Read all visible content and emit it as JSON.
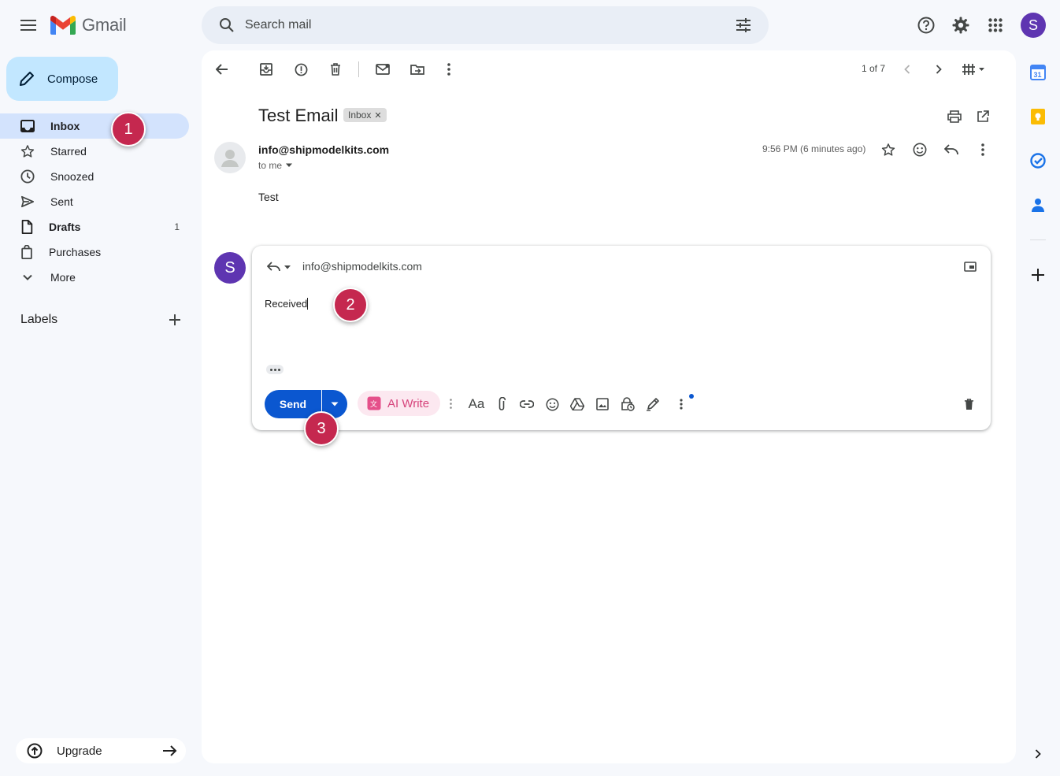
{
  "app": {
    "name": "Gmail",
    "avatar_letter": "S"
  },
  "search": {
    "placeholder": "Search mail"
  },
  "compose": {
    "label": "Compose"
  },
  "sidebar": {
    "items": [
      {
        "label": "Inbox",
        "count": "",
        "icon": "inbox-icon"
      },
      {
        "label": "Starred",
        "count": "",
        "icon": "star-icon"
      },
      {
        "label": "Snoozed",
        "count": "",
        "icon": "clock-icon"
      },
      {
        "label": "Sent",
        "count": "",
        "icon": "send-icon"
      },
      {
        "label": "Drafts",
        "count": "1",
        "icon": "draft-icon"
      },
      {
        "label": "Purchases",
        "count": "",
        "icon": "bag-icon"
      },
      {
        "label": "More",
        "count": "",
        "icon": "chevron-down-icon"
      }
    ],
    "labels_heading": "Labels",
    "upgrade_label": "Upgrade"
  },
  "toolbar": {
    "page_count": "1 of 7"
  },
  "message": {
    "subject": "Test Email",
    "chip_label": "Inbox",
    "sender": "info@shipmodelkits.com",
    "recipient": "to me",
    "timestamp": "9:56 PM (6 minutes ago)",
    "body": "Test"
  },
  "reply": {
    "avatar_letter": "S",
    "to": "info@shipmodelkits.com",
    "body": "Received",
    "send_label": "Send",
    "ai_write_label": "AI Write"
  },
  "markers": [
    "1",
    "2",
    "3"
  ],
  "colors": {
    "accent": "#0b57d0",
    "compose_bg": "#c2e7ff",
    "active_nav": "#d3e3fd",
    "marker": "#c5284f",
    "avatar": "#5e35b1"
  }
}
